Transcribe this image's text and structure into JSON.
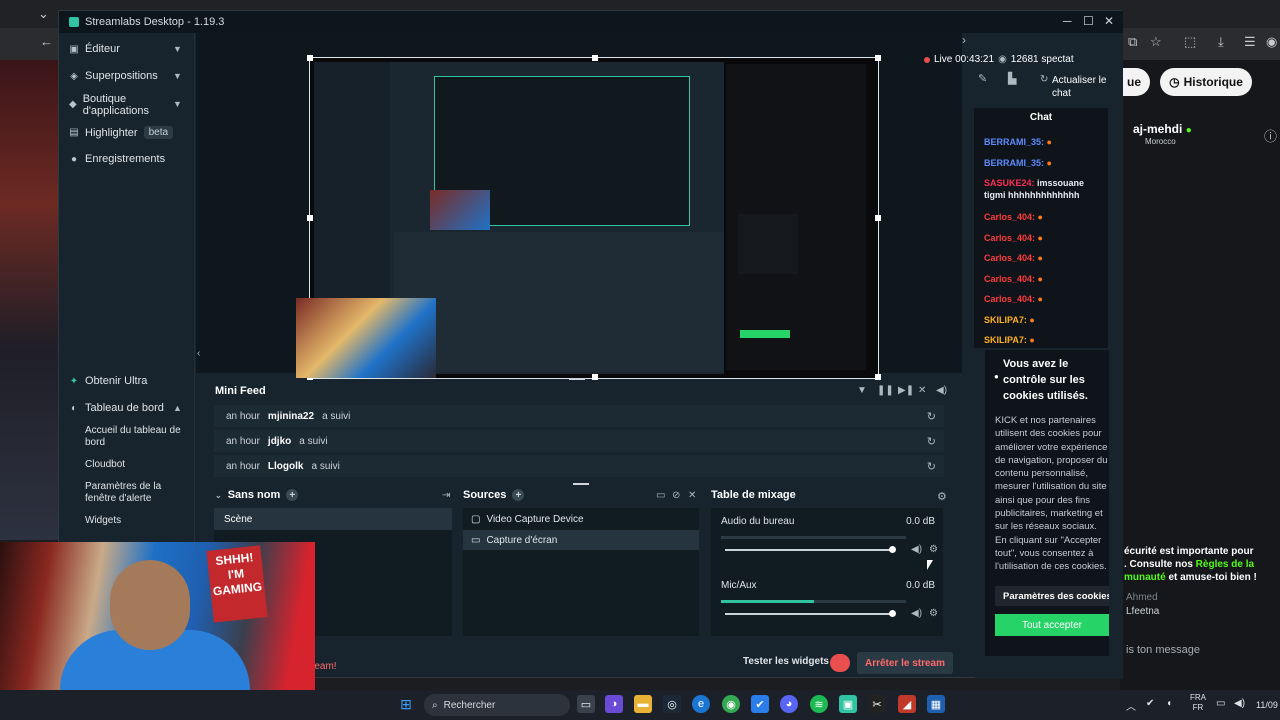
{
  "browser": {
    "history_label": "Historique",
    "left_pill_label": "ue"
  },
  "window": {
    "title": "Streamlabs Desktop - 1.19.3",
    "minimize": "─",
    "maximize": "☐",
    "close": "✕"
  },
  "sidebar": {
    "items": [
      {
        "label": "Éditeur",
        "icon": "editor-icon"
      },
      {
        "label": "Superpositions",
        "icon": "overlays-icon"
      },
      {
        "label": "Boutique d'applications",
        "icon": "app-store-icon"
      },
      {
        "label": "Highlighter",
        "icon": "highlighter-icon",
        "badge": "beta"
      },
      {
        "label": "Enregistrements",
        "icon": "recordings-icon"
      }
    ],
    "bottom_items": [
      {
        "label": "Obtenir Ultra"
      },
      {
        "label": "Tableau de bord"
      }
    ],
    "dashboard_sub": [
      "Accueil du tableau de bord",
      "Cloudbot",
      "Paramètres de la fenêtre d'alerte",
      "Widgets"
    ]
  },
  "minifeed": {
    "title": "Mini Feed",
    "rows": [
      {
        "time": "an hour",
        "user": "mjinina22",
        "action": "a suivi"
      },
      {
        "time": "an hour",
        "user": "jdjko",
        "action": "a suivi"
      },
      {
        "time": "an hour",
        "user": "Llogolk",
        "action": "a suivi"
      }
    ]
  },
  "scenes": {
    "title": "Sans nom",
    "items": [
      "Scène"
    ]
  },
  "sources": {
    "title": "Sources",
    "items": [
      "Video Capture Device",
      "Capture d'écran"
    ]
  },
  "mixer": {
    "title": "Table de mixage",
    "channels": [
      {
        "name": "Audio du bureau",
        "db": "0.0 dB",
        "level": 0
      },
      {
        "name": "Mic/Aux",
        "db": "0.0 dB",
        "level": 0.5
      }
    ]
  },
  "footer": {
    "test_widgets": "Tester les widgets",
    "stop_stream": "Arrêter le stream",
    "go_live_fragment": "ream!"
  },
  "live": {
    "status": "Live 00:43:21",
    "viewers": "12681 spectat",
    "refresh_chat": "Actualiser le chat"
  },
  "chat": {
    "title": "Chat",
    "messages": [
      {
        "user": "BERRAMI_35:",
        "text": "",
        "color": "#5d8cff"
      },
      {
        "user": "BERRAMI_35:",
        "text": "",
        "color": "#5d8cff"
      },
      {
        "user": "SASUKE24:",
        "text": "imssouane tigmi hhhhhhhhhhhhh",
        "color": "#ff2d55"
      },
      {
        "user": "Carlos_404:",
        "text": "",
        "color": "#ff3b3b"
      },
      {
        "user": "Carlos_404:",
        "text": "",
        "color": "#ff3b3b"
      },
      {
        "user": "Carlos_404:",
        "text": "",
        "color": "#ff3b3b"
      },
      {
        "user": "Carlos_404:",
        "text": "",
        "color": "#ff3b3b"
      },
      {
        "user": "Carlos_404:",
        "text": "",
        "color": "#ff3b3b"
      },
      {
        "user": "SKILIPA7:",
        "text": "",
        "color": "#ffb020"
      },
      {
        "user": "SKILIPA7:",
        "text": "",
        "color": "#ffb020"
      }
    ]
  },
  "cookie": {
    "title": "Vous avez le contrôle sur les cookies utilisés.",
    "body": "KICK et nos partenaires utilisent des cookies pour améliorer votre expérience de navigation, proposer du contenu personnalisé, mesurer l'utilisation du site ainsi que pour des fins publicitaires, marketing et sur les réseaux sociaux. En cliquant sur \"Accepter tout\", vous consentez à l'utilisation de ces cookies.",
    "settings_label": "Paramètres des cookies",
    "accept_label": "Tout accepter"
  },
  "kick": {
    "username": "aj-mehdi",
    "country": "Morocco",
    "warning_prefix": "écurité est importante pour",
    "warning_middle": ". Consulte nos ",
    "warning_link1": "Règles de la",
    "warning_link2": "munauté",
    "warning_suffix": " et amuse-toi bien !",
    "chat_user": "Ahmed",
    "chat_text": "Lfeetna",
    "input_placeholder": "is ton message"
  },
  "webcam": {
    "sign_text": "SHHH! I'M GAMING"
  },
  "taskbar": {
    "search_label": "Rechercher",
    "lang_line1": "FRA",
    "lang_line2": "FR",
    "date": "11/09"
  },
  "colors": {
    "accent": "#31c3a2",
    "stop_red": "#ff6a6a",
    "kick_green": "#53fc18",
    "accept_green": "#25d366"
  }
}
